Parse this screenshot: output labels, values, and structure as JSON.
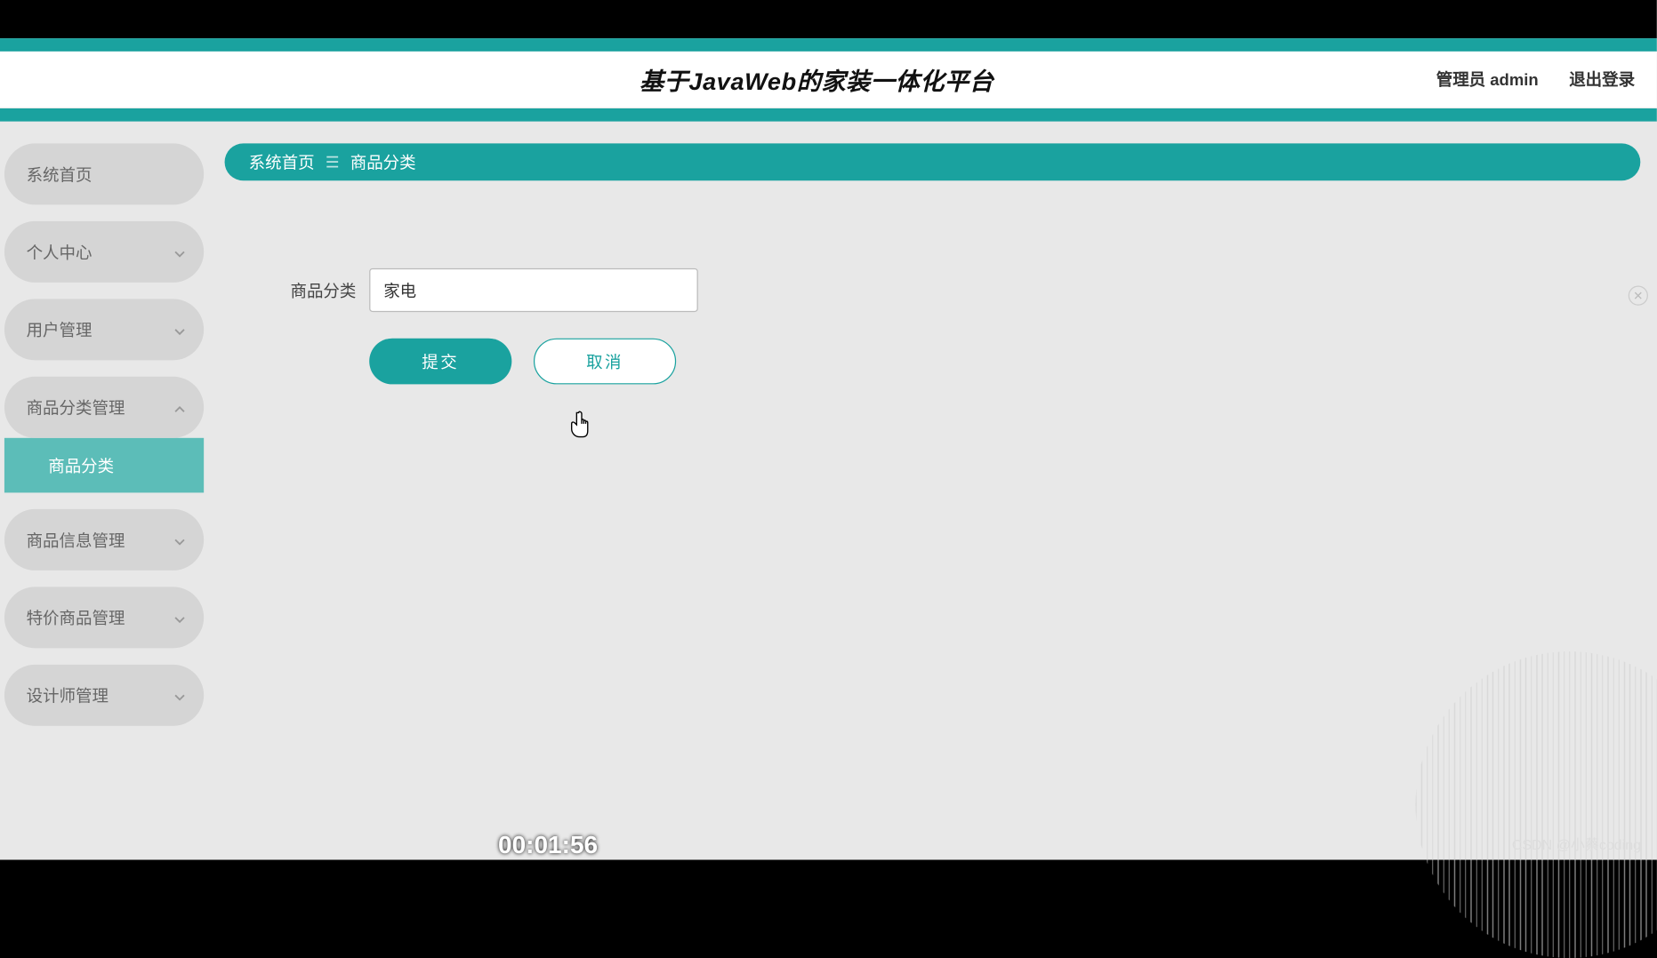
{
  "header": {
    "title": "基于JavaWeb的家装一体化平台",
    "admin_label": "管理员 admin",
    "logout_label": "退出登录"
  },
  "sidebar": {
    "items": [
      {
        "label": "系统首页",
        "expandable": false
      },
      {
        "label": "个人中心",
        "expandable": true
      },
      {
        "label": "用户管理",
        "expandable": true
      },
      {
        "label": "商品分类管理",
        "expandable": true,
        "expanded": true
      },
      {
        "label": "商品信息管理",
        "expandable": true
      },
      {
        "label": "特价商品管理",
        "expandable": true
      },
      {
        "label": "设计师管理",
        "expandable": true
      }
    ],
    "active_sub": "商品分类"
  },
  "breadcrumb": {
    "home": "系统首页",
    "separator": "☰",
    "current": "商品分类"
  },
  "form": {
    "label": "商品分类",
    "value": "家电",
    "submit": "提交",
    "cancel": "取消"
  },
  "video": {
    "timestamp": "00:01:56"
  },
  "watermark": "CSDN @小蔡coding",
  "colors": {
    "accent": "#1aa29f",
    "sidebar_active": "#5cbdb8"
  }
}
